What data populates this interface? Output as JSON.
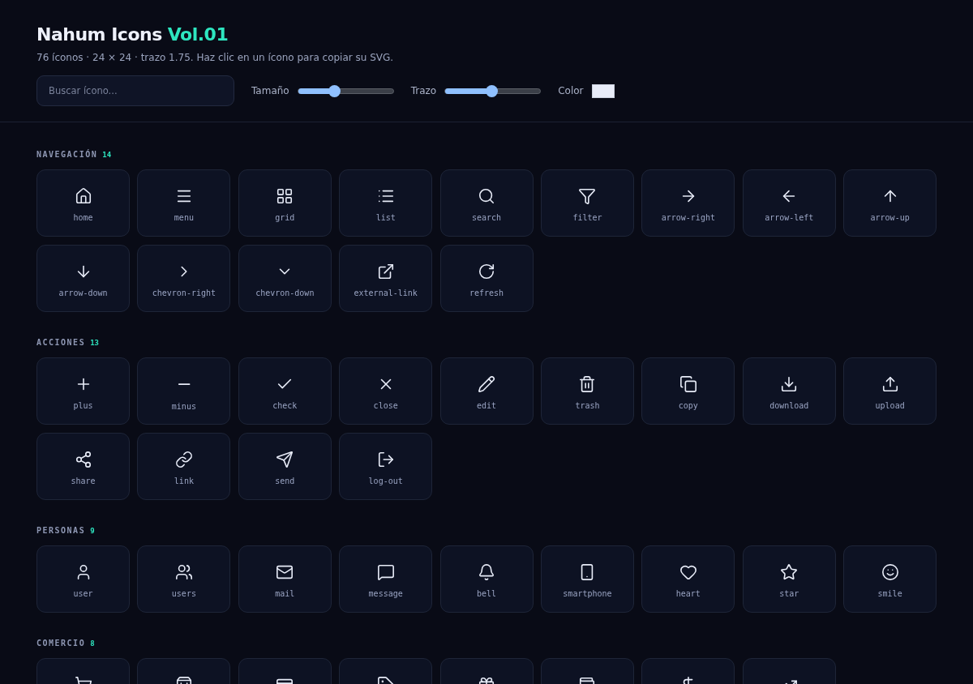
{
  "header": {
    "title": "Nahum Icons",
    "version": "Vol.01",
    "subtitle": "76 íconos · 24 × 24 · trazo 1.75. Haz clic en un ícono para copiar su SVG."
  },
  "controls": {
    "search": {
      "placeholder": "Buscar ícono..."
    },
    "sliders": [
      {
        "label": "Tamaño",
        "level": 0.38
      },
      {
        "label": "Trazo",
        "level": 0.49
      }
    ],
    "color": {
      "label": "Color",
      "color": "#e8ecf8"
    }
  },
  "sections": [
    {
      "title": "NAVEGACIÓN",
      "count": "14",
      "items": [
        {
          "kind": "home",
          "label": "home"
        },
        {
          "kind": "menu",
          "label": "menu"
        },
        {
          "kind": "grid",
          "label": "grid"
        },
        {
          "kind": "list",
          "label": "list"
        },
        {
          "kind": "search",
          "label": "search"
        },
        {
          "kind": "filter",
          "label": "filter"
        },
        {
          "kind": "arrow-right",
          "label": "arrow-right"
        },
        {
          "kind": "arrow-left",
          "label": "arrow-left"
        },
        {
          "kind": "arrow-up",
          "label": "arrow-up"
        },
        {
          "kind": "arrow-down",
          "label": "arrow-down"
        },
        {
          "kind": "chevron-right",
          "label": "chevron-right"
        },
        {
          "kind": "chevron-down",
          "label": "chevron-down"
        },
        {
          "kind": "external-link",
          "label": "external-link"
        },
        {
          "kind": "refresh",
          "label": "refresh"
        }
      ]
    },
    {
      "title": "ACCIONES",
      "count": "13",
      "items": [
        {
          "kind": "plus",
          "label": "plus"
        },
        {
          "kind": "minus",
          "label": "minus"
        },
        {
          "kind": "check",
          "label": "check"
        },
        {
          "kind": "close",
          "label": "close"
        },
        {
          "kind": "edit",
          "label": "edit"
        },
        {
          "kind": "trash",
          "label": "trash"
        },
        {
          "kind": "copy",
          "label": "copy"
        },
        {
          "kind": "download",
          "label": "download"
        },
        {
          "kind": "upload",
          "label": "upload"
        },
        {
          "kind": "share",
          "label": "share"
        },
        {
          "kind": "link",
          "label": "link"
        },
        {
          "kind": "send",
          "label": "send"
        },
        {
          "kind": "log-out",
          "label": "log-out"
        }
      ]
    },
    {
      "title": "PERSONAS",
      "count": "9",
      "items": [
        {
          "kind": "user",
          "label": "user"
        },
        {
          "kind": "users",
          "label": "users"
        },
        {
          "kind": "mail",
          "label": "mail"
        },
        {
          "kind": "message",
          "label": "message"
        },
        {
          "kind": "bell",
          "label": "bell"
        },
        {
          "kind": "smartphone",
          "label": "smartphone"
        },
        {
          "kind": "heart",
          "label": "heart"
        },
        {
          "kind": "star",
          "label": "star"
        },
        {
          "kind": "smile",
          "label": "smile"
        }
      ]
    },
    {
      "title": "COMERCIO",
      "count": "8",
      "items": [
        {
          "kind": "cart"
        },
        {
          "kind": "bag"
        },
        {
          "kind": "card"
        },
        {
          "kind": "tag"
        },
        {
          "kind": "gift"
        },
        {
          "kind": "wallet"
        },
        {
          "kind": "dollar"
        },
        {
          "kind": "trending"
        }
      ]
    }
  ]
}
